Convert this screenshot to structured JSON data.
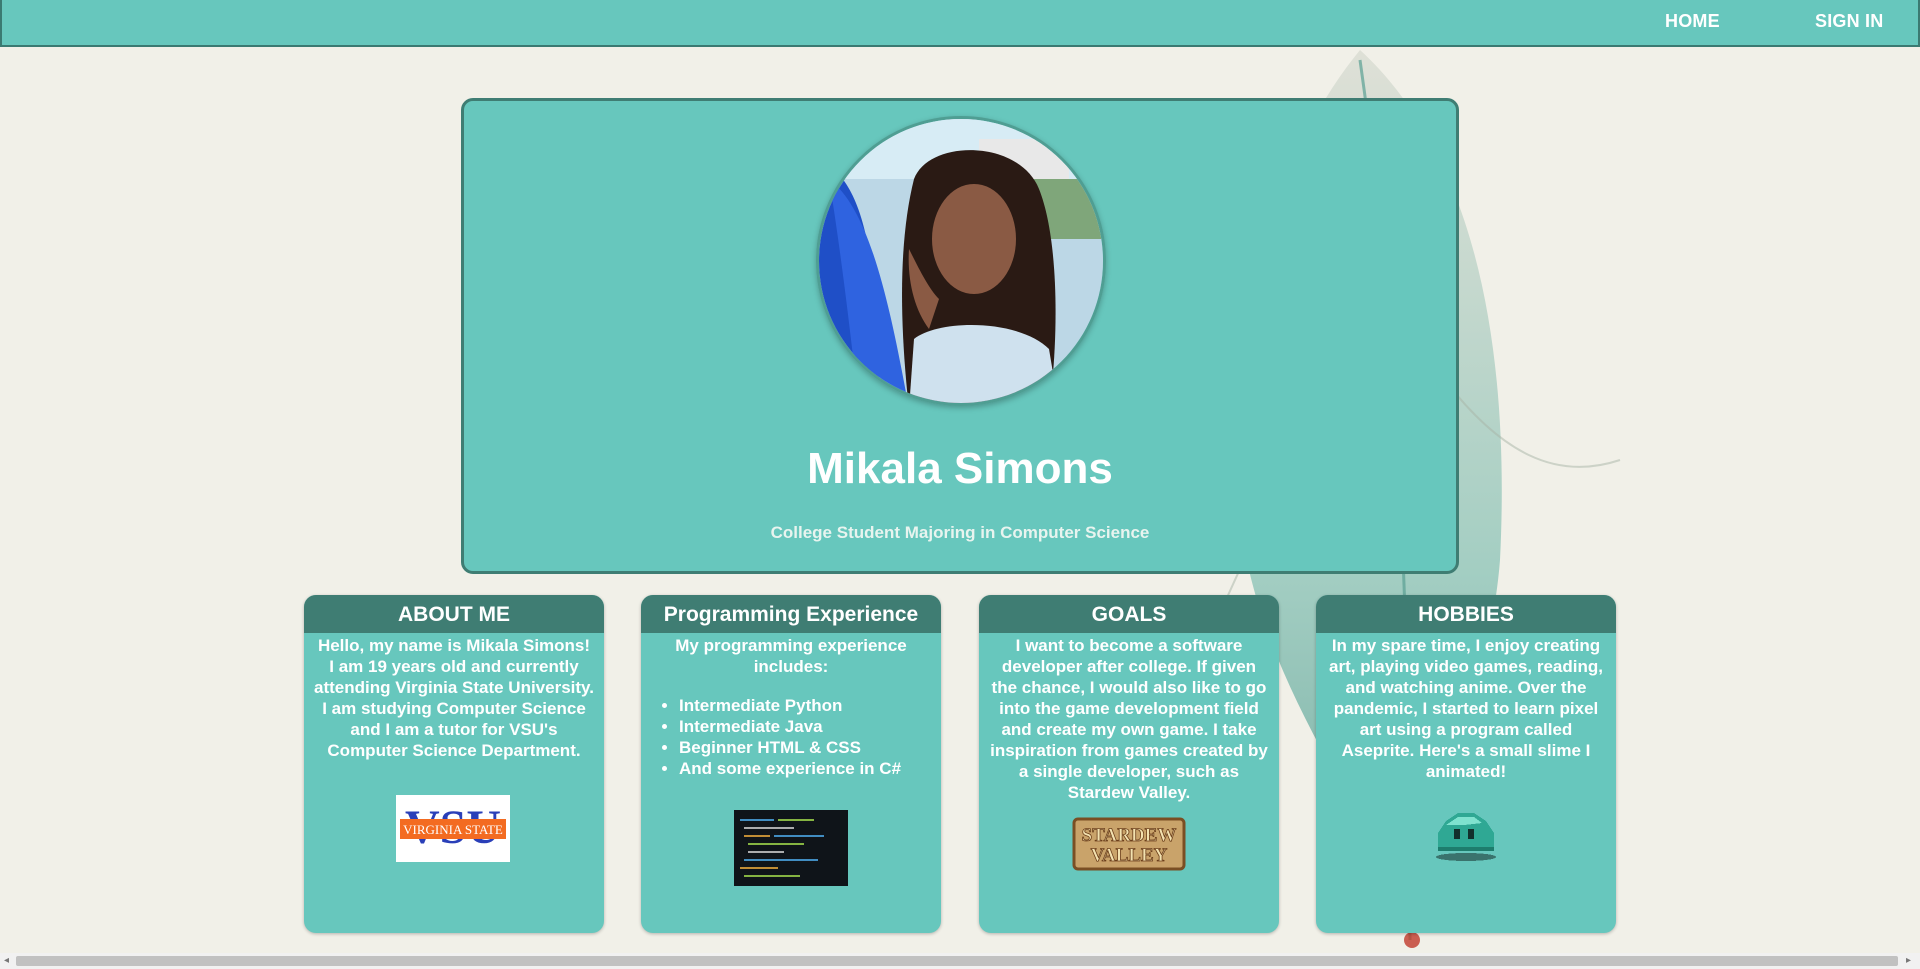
{
  "nav": {
    "home": "HOME",
    "sign_in": "SIGN IN"
  },
  "hero": {
    "name": "Mikala Simons",
    "subtitle": "College Student Majoring in Computer Science"
  },
  "cards": {
    "about": {
      "title": "ABOUT ME",
      "text": "Hello, my name is Mikala Simons! I am 19 years old and currently attending Virginia State University. I am studying Computer Science and I am a tutor for VSU's Computer Science Department.",
      "logo_main": "VSU",
      "logo_banner": "VIRGINIA STATE"
    },
    "programming": {
      "title": "Programming Experience",
      "intro": "My programming experience includes:",
      "items": [
        "Intermediate Python",
        "Intermediate Java",
        "Beginner HTML & CSS",
        "And some experience in C#"
      ]
    },
    "goals": {
      "title": "GOALS",
      "text": "I want to become a software developer after college. If given the chance, I would also like to go into the game development field and create my own game. I take inspiration from games created by a single developer, such as Stardew Valley.",
      "logo_line1": "STARDEW",
      "logo_line2": "VALLEY"
    },
    "hobbies": {
      "title": "HOBBIES",
      "text": "In my spare time, I enjoy creating art, playing video games, reading, and watching anime. Over the pandemic, I started to learn pixel art using a program called Aseprite. Here's a small slime I animated!"
    }
  },
  "colors": {
    "teal": "#67c7bd",
    "dark_teal": "#3f7d73",
    "background": "#f1f0e8"
  }
}
